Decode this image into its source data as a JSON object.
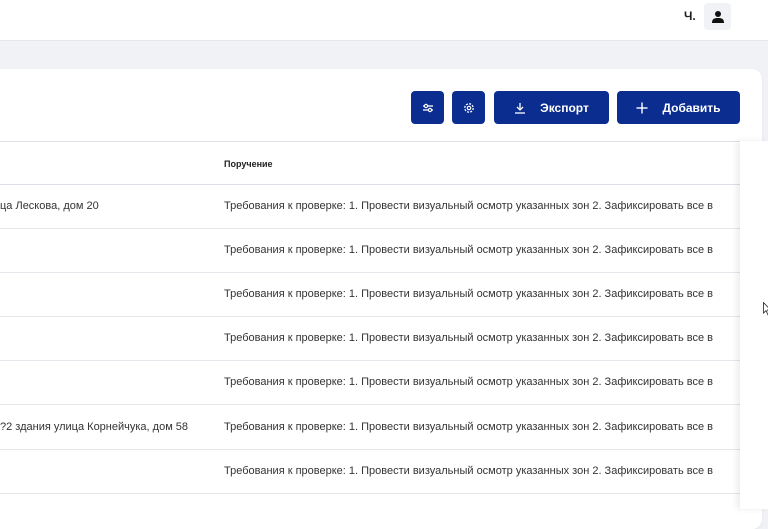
{
  "header": {
    "user_name": "Ч.",
    "avatar_icon": "user-icon"
  },
  "toolbar": {
    "filter_icon": "sliders-icon",
    "settings_icon": "gear-icon",
    "export_label": "Экспорт",
    "export_icon": "download-icon",
    "add_label": "Добавить",
    "add_icon": "plus-icon",
    "accent_color": "#0b2d8f"
  },
  "table": {
    "columns": [
      "Поручение"
    ],
    "rows": [
      {
        "address": "ца Лескова, дом 20",
        "order": "Требования к проверке: 1. Провести визуальный осмотр указанных зон 2. Зафиксировать все в"
      },
      {
        "address": "",
        "order": "Требования к проверке: 1. Провести визуальный осмотр указанных зон 2. Зафиксировать все в"
      },
      {
        "address": "",
        "order": "Требования к проверке: 1. Провести визуальный осмотр указанных зон 2. Зафиксировать все в"
      },
      {
        "address": "",
        "order": "Требования к проверке: 1. Провести визуальный осмотр указанных зон 2. Зафиксировать все в"
      },
      {
        "address": "",
        "order": "Требования к проверке: 1. Провести визуальный осмотр указанных зон 2. Зафиксировать все в"
      },
      {
        "address": "?2 здания улица Корнейчука, дом 58",
        "order": "Требования к проверке: 1. Провести визуальный осмотр указанных зон 2. Зафиксировать все в"
      },
      {
        "address": "",
        "order": "Требования к проверке: 1. Провести визуальный осмотр указанных зон 2. Зафиксировать все в"
      }
    ]
  }
}
